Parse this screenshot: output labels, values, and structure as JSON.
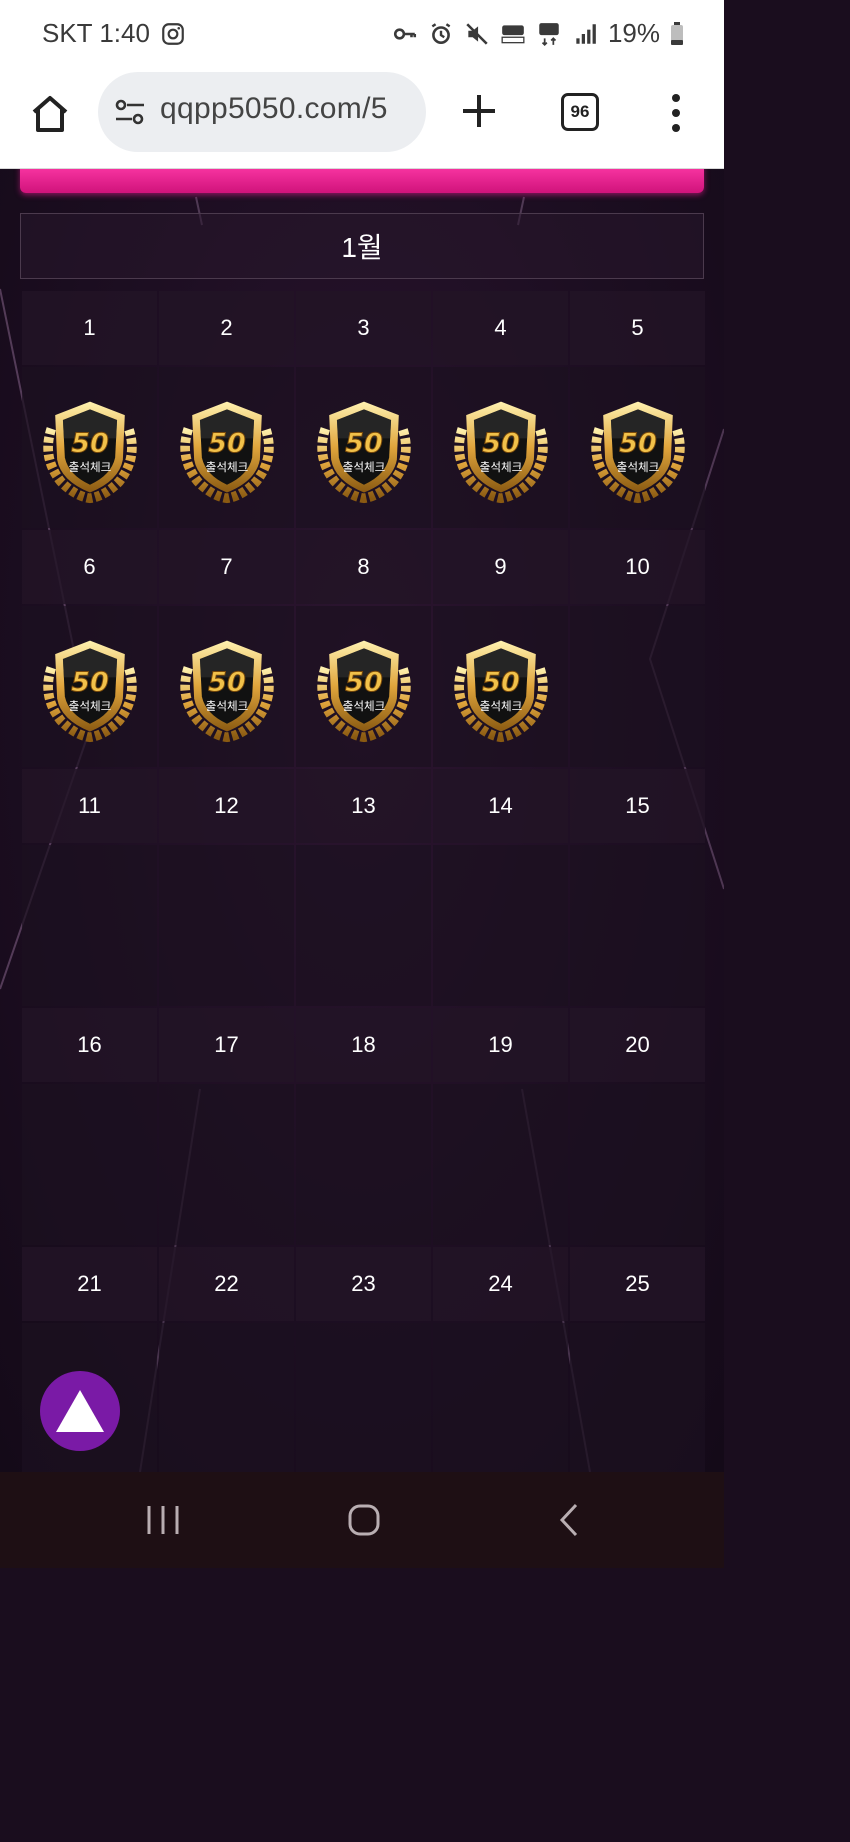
{
  "status_bar": {
    "carrier_time": "SKT 1:40",
    "battery": "19%",
    "icons": [
      "instagram-icon",
      "vpn-key-icon",
      "alarm-icon",
      "mute-icon",
      "hd-voice-icon",
      "5g-icon",
      "signal-icon",
      "battery-icon"
    ]
  },
  "browser": {
    "url": "qqpp5050.com/5",
    "tab_count": "96",
    "icons": [
      "home-icon",
      "site-info-icon",
      "plus-icon",
      "tabs-icon",
      "more-icon"
    ]
  },
  "calendar": {
    "month": "1월",
    "stamp_label": "출석체크",
    "stamp_number": "50",
    "weeks": [
      {
        "days": [
          "1",
          "2",
          "3",
          "4",
          "5"
        ],
        "stamped": [
          true,
          true,
          true,
          true,
          true
        ]
      },
      {
        "days": [
          "6",
          "7",
          "8",
          "9",
          "10"
        ],
        "stamped": [
          true,
          true,
          true,
          true,
          false
        ]
      },
      {
        "days": [
          "11",
          "12",
          "13",
          "14",
          "15"
        ],
        "stamped": [
          false,
          false,
          false,
          false,
          false
        ]
      },
      {
        "days": [
          "16",
          "17",
          "18",
          "19",
          "20"
        ],
        "stamped": [
          false,
          false,
          false,
          false,
          false
        ]
      },
      {
        "days": [
          "21",
          "22",
          "23",
          "24",
          "25"
        ],
        "stamped": [
          false,
          false,
          false,
          false,
          false
        ]
      }
    ]
  },
  "colors": {
    "accent_pink": "#e0188a",
    "scroll_button": "#7a1aa6",
    "background": "#1d0e22",
    "gold": "#d9a441"
  },
  "nav_bar": {
    "icons": [
      "recent-apps-icon",
      "home-circle-icon",
      "back-icon"
    ]
  }
}
